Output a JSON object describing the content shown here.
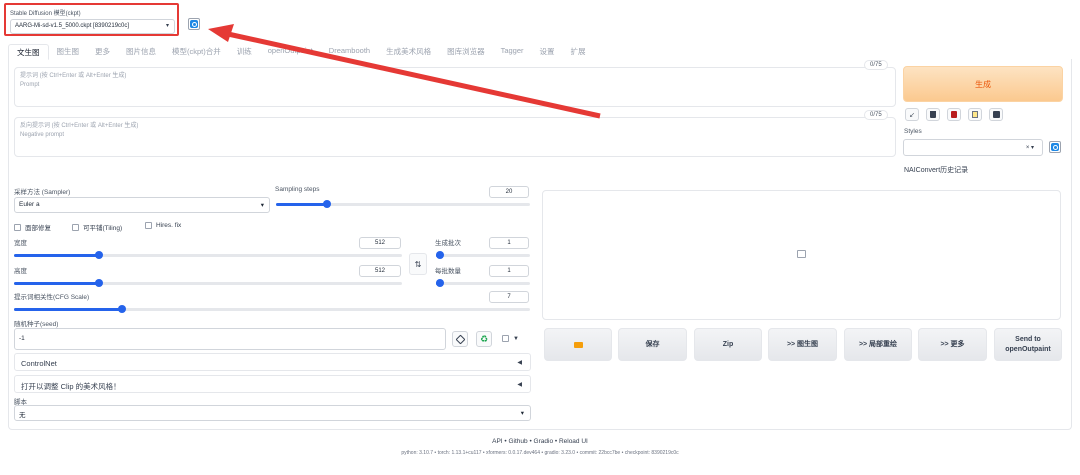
{
  "model": {
    "label": "Stable Diffusion 模型(ckpt)",
    "value": "AARG-Mi-sd-v1.5_5000.ckpt [8390219c0c]"
  },
  "tabs": [
    "文生图",
    "图生图",
    "更多",
    "图片信息",
    "模型(ckpt)合并",
    "训练",
    "openOutpaint",
    "Dreambooth",
    "生成美术风格",
    "图库浏览器",
    "Tagger",
    "设置",
    "扩展"
  ],
  "prompt": {
    "placeholder_line1": "提示词 (按 Ctrl+Enter 或 Alt+Enter 生成)",
    "placeholder_line2": "Prompt",
    "counter": "0/75"
  },
  "negative_prompt": {
    "placeholder_line1": "反向提示词 (按 Ctrl+Enter 或 Alt+Enter 生成)",
    "placeholder_line2": "Negative prompt",
    "counter": "0/75"
  },
  "generate_label": "生成",
  "styles_label": "Styles",
  "styles_clear": "× ▾",
  "naiconvert_label": "NAIConvert历史记录",
  "sampler": {
    "label": "采样方法 (Sampler)",
    "value": "Euler a"
  },
  "steps": {
    "label": "Sampling steps",
    "value": "20",
    "fraction": 0.2
  },
  "checkboxes": [
    "面部修复",
    "可平铺(Tiling)",
    "Hires. fix"
  ],
  "width": {
    "label": "宽度",
    "value": "512",
    "fraction": 0.22
  },
  "height": {
    "label": "高度",
    "value": "512",
    "fraction": 0.22
  },
  "swap_icon": "⇅",
  "batch_count": {
    "label": "生成批次",
    "value": "1",
    "fraction": 0.02
  },
  "batch_size": {
    "label": "每批数量",
    "value": "1",
    "fraction": 0.02
  },
  "cfg": {
    "label": "提示词相关性(CFG Scale)",
    "value": "7",
    "fraction": 0.21
  },
  "seed": {
    "label": "随机种子(seed)",
    "value": "-1"
  },
  "accordions": [
    "ControlNet",
    "打开以调整 Clip 的美术风格！"
  ],
  "accordion_arrow": "◀",
  "script": {
    "label": "脚本",
    "value": "无"
  },
  "actions": [
    "",
    "保存",
    "Zip",
    ">> 图生图",
    ">> 局部重绘",
    ">> 更多",
    "Send to\nopenOutpaint"
  ],
  "footer": {
    "links": "API • Github • Gradio • Reload UI",
    "versions": "python: 3.10.7  •  torch: 1.13.1+cu117  •  xformers: 0.0.17.dev464  •  gradio: 3.23.0  •  commit: 22bcc7be  •  checkpoint: 8390219c0c"
  },
  "colors": {
    "accent": "#2563eb",
    "generate": "#ea580c",
    "highlight": "#e53935"
  }
}
